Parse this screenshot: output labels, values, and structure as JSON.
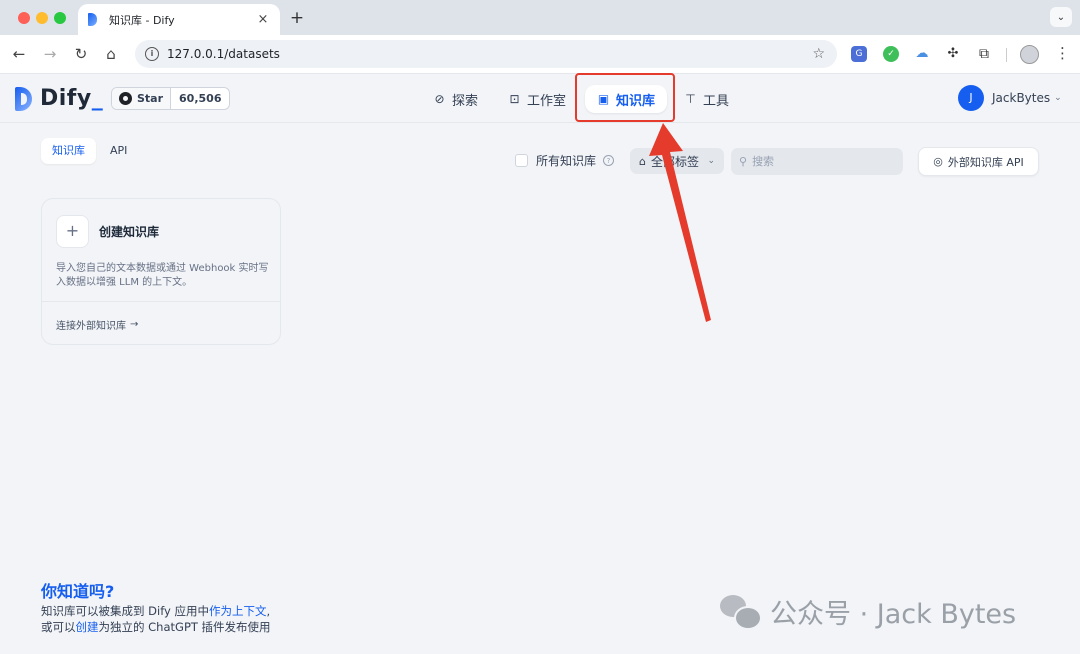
{
  "browser": {
    "tab_title": "知识库 - Dify",
    "tab_close": "×",
    "new_tab": "+",
    "url": "127.0.0.1/datasets",
    "nav": {
      "back": "←",
      "forward": "→",
      "reload": "↻",
      "home": "⌂"
    }
  },
  "header": {
    "logo_text": "Dify",
    "logo_suffix": "_",
    "github": {
      "label": "Star",
      "count": "60,506"
    },
    "nav": [
      {
        "label": "探索",
        "icon": "compass-icon"
      },
      {
        "label": "工作室",
        "icon": "robot-icon"
      },
      {
        "label": "知识库",
        "icon": "book-icon",
        "active": true
      },
      {
        "label": "工具",
        "icon": "hammer-icon"
      }
    ],
    "user": {
      "initial": "J",
      "name": "JackBytes"
    }
  },
  "subtabs": [
    {
      "label": "知识库",
      "active": true
    },
    {
      "label": "API",
      "active": false
    }
  ],
  "filters": {
    "all_knowledge_label": "所有知识库",
    "tag_filter_label": "全部标签",
    "search_placeholder": "搜索",
    "external_api_label": "外部知识库 API"
  },
  "create_card": {
    "plus": "+",
    "title": "创建知识库",
    "description": "导入您自己的文本数据或通过 Webhook 实时写入数据以增强 LLM 的上下文。",
    "connect_link": "连接外部知识库",
    "arrow": "→"
  },
  "tips": {
    "title": "你知道吗?",
    "line1_prefix": "知识库可以被集成到 Dify 应用中",
    "line1_link": "作为上下文",
    "line1_suffix": ",",
    "line2_prefix": "或可以",
    "line2_link": "创建",
    "line2_suffix": "为独立的 ChatGPT 插件发布使用"
  },
  "watermark": {
    "text": "公众号 · Jack Bytes"
  },
  "colors": {
    "accent": "#155eef",
    "annotation": "#e53b2c",
    "background": "#f2f4f7"
  }
}
